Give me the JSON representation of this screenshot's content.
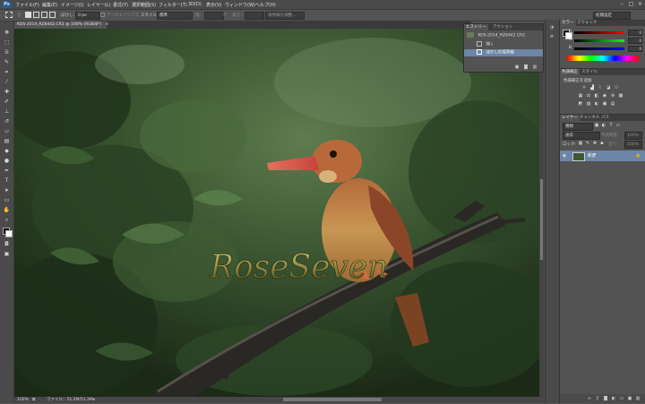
{
  "app": {
    "logo": "Ps"
  },
  "menu": {
    "items": [
      "ファイル(F)",
      "編集(E)",
      "イメージ(I)",
      "レイヤー(L)",
      "書式(Y)",
      "選択範囲(S)",
      "フィルター(T)",
      "3D(D)",
      "表示(V)",
      "ウィンドウ(W)",
      "ヘルプ(H)"
    ],
    "window_buttons": [
      "–",
      "□",
      "×"
    ]
  },
  "options": {
    "feather_label": "ぼかし：",
    "feather_value": "0 px",
    "antialias_label": "アンチエイリアス",
    "style_label": "スタイル：",
    "style_value": "標準",
    "width_label": "幅：",
    "height_label": "高さ：",
    "refine_button": "境界線を調整...",
    "workspace": "初期設定"
  },
  "document": {
    "tab_title": "KOS-2014_RZ6442.CR2 @ 100% (RGB/8*)",
    "close_glyph": "×",
    "watermark": "RoseSeven"
  },
  "status": {
    "zoom": "100%",
    "file_info": "ファイル：51.2M/51.2M"
  },
  "history": {
    "tabs": [
      "ヒストリー",
      "アクション"
    ],
    "snapshot": "KOS-2014_RZ6442.CR2",
    "items": [
      {
        "label": "開く",
        "selected": false
      },
      {
        "label": "ぼかしの境界線",
        "selected": true
      }
    ]
  },
  "color_panel": {
    "tabs": [
      "カラー",
      "スウォッチ"
    ],
    "channels": [
      {
        "label": "R",
        "value": "0",
        "gradient": "linear-gradient(90deg,#000,#f00)"
      },
      {
        "label": "G",
        "value": "0",
        "gradient": "linear-gradient(90deg,#000,#0f0)"
      },
      {
        "label": "B",
        "value": "0",
        "gradient": "linear-gradient(90deg,#000,#00f)"
      }
    ]
  },
  "adjust_panel": {
    "tabs": [
      "色調補正",
      "スタイル"
    ],
    "subtitle": "色調補正を追加"
  },
  "layers_panel": {
    "tabs": [
      "レイヤー",
      "チャンネル",
      "パス"
    ],
    "kind_filter": "種類",
    "blend_mode": "通常",
    "opacity_label": "不透明度：",
    "opacity_value": "100%",
    "lock_label": "ロック：",
    "fill_label": "塗り：",
    "fill_value": "100%",
    "layers": [
      {
        "name": "背景"
      }
    ],
    "eye_glyph": "◉",
    "lock_glyph": "🔒"
  },
  "colors": {
    "accent_selection": "#6d85a6",
    "panel_bg": "#535353",
    "canvas_dark": "#2c4127"
  }
}
